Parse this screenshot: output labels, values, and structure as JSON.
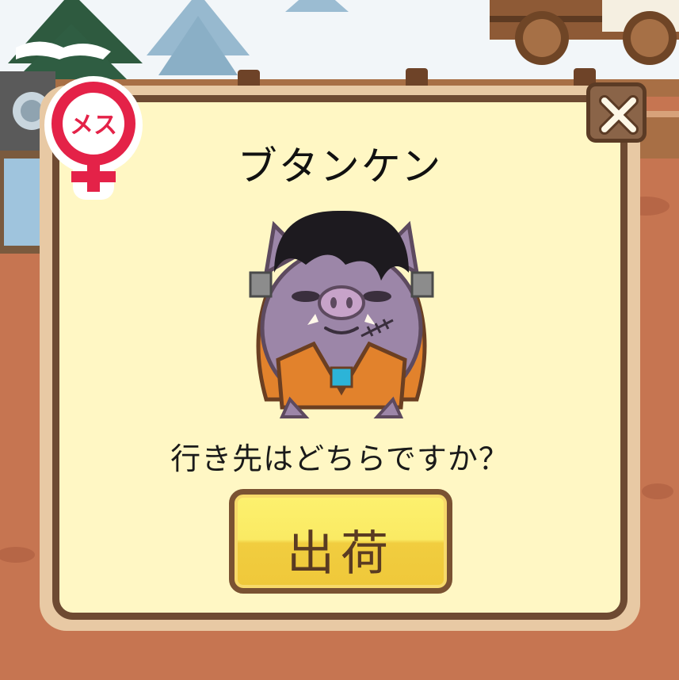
{
  "dialog": {
    "title": "ブタンケン",
    "question": "行き先はどちらですか？",
    "ship_button_label": "出荷",
    "gender_badge_label": "メス"
  },
  "icons": {
    "close": "close-icon",
    "gender": "female-symbol-icon",
    "character": "frankenstein-boar-character"
  },
  "colors": {
    "panel": "#fff7c4",
    "panel_border": "#6e4a32",
    "button_yellow": "#f6dc4c",
    "badge_red": "#e42248",
    "ground": "#c2704a"
  }
}
